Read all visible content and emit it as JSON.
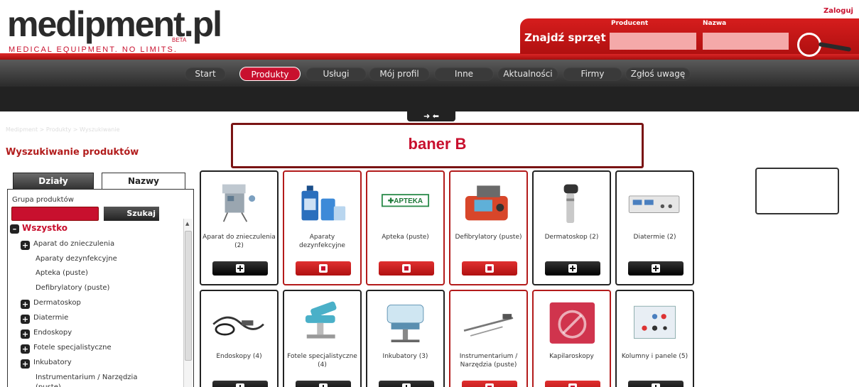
{
  "brand": {
    "name": "medipment.pl",
    "beta": "BETA",
    "tagline": "MEDICAL EQUIPMENT. NO LIMITS."
  },
  "header": {
    "login": "Zaloguj"
  },
  "search": {
    "title": "Znajdź sprzęt",
    "producer_label": "Producent",
    "name_label": "Nazwa"
  },
  "nav": {
    "items": [
      "Start",
      "Produkty",
      "Usługi",
      "Mój profil",
      "Inne",
      "Aktualności",
      "Firmy",
      "Zgłoś uwagę"
    ],
    "active": "Produkty",
    "toggle": "➜ ⬅"
  },
  "page": {
    "breadcrumb": "Medipment > Produkty > Wyszukiwanie",
    "title": "Wyszukiwanie produktów"
  },
  "banner": {
    "text": "baner B"
  },
  "sidebar": {
    "tabs": [
      "Działy",
      "Nazwy"
    ],
    "group_label": "Grupa produktów",
    "search_button": "Szukaj",
    "tree": [
      {
        "label": "Wszystko",
        "icon": "minus",
        "level": 0
      },
      {
        "label": "Aparat do znieczulenia",
        "icon": "plus",
        "level": 1
      },
      {
        "label": "Aparaty dezynfekcyjne",
        "icon": "none",
        "level": 2
      },
      {
        "label": "Apteka (puste)",
        "icon": "none",
        "level": 2
      },
      {
        "label": "Defibrylatory (puste)",
        "icon": "none",
        "level": 2
      },
      {
        "label": "Dermatoskop",
        "icon": "plus",
        "level": 1
      },
      {
        "label": "Diatermie",
        "icon": "plus",
        "level": 1
      },
      {
        "label": "Endoskopy",
        "icon": "plus",
        "level": 1
      },
      {
        "label": "Fotele specjalistyczne",
        "icon": "plus",
        "level": 1
      },
      {
        "label": "Inkubatory",
        "icon": "plus",
        "level": 1
      },
      {
        "label": "Instrumentarium / Narzędzia",
        "icon": "none",
        "level": 2
      },
      {
        "label": "(puste)",
        "icon": "none",
        "level": 2
      }
    ]
  },
  "products": [
    {
      "name": "Aparat do znieczulenia (2)",
      "style": "dark",
      "icon": "anesthesia-machine-icon"
    },
    {
      "name": "Aparaty dezynfekcyjne",
      "style": "red",
      "icon": "disinfectant-bottles-icon"
    },
    {
      "name": "Apteka (puste)",
      "style": "red",
      "icon": "pharmacy-sign-icon"
    },
    {
      "name": "Defibrylatory (puste)",
      "style": "red",
      "icon": "defibrillator-icon"
    },
    {
      "name": "Dermatoskop (2)",
      "style": "dark",
      "icon": "dermatoscope-icon"
    },
    {
      "name": "Diatermie (2)",
      "style": "dark",
      "icon": "diathermy-unit-icon"
    },
    {
      "name": "Endoskopy (4)",
      "style": "dark",
      "icon": "endoscope-icon"
    },
    {
      "name": "Fotele specjalistyczne (4)",
      "style": "dark",
      "icon": "exam-chair-icon"
    },
    {
      "name": "Inkubatory (3)",
      "style": "dark",
      "icon": "incubator-icon"
    },
    {
      "name": "Instrumentarium / Narzędzia (puste)",
      "style": "red",
      "icon": "surgical-instrument-icon"
    },
    {
      "name": "Kapilaroskopy",
      "style": "red",
      "icon": "no-image-placeholder-icon"
    },
    {
      "name": "Kolumny i panele (5)",
      "style": "dark",
      "icon": "wall-panel-icon"
    }
  ],
  "colors": {
    "brand_red": "#c8102e",
    "nav_dark": "#222222",
    "title_red": "#b21d1d"
  }
}
